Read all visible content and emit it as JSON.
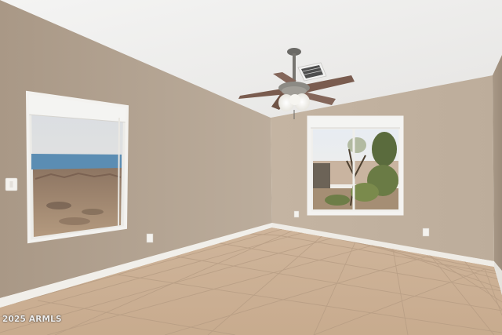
{
  "scene": {
    "description_tag": "empty-room-photo",
    "watermark": "2025 ARMLS"
  },
  "colors": {
    "ceiling": "#eeeeec",
    "wall_left": "#b5a696",
    "wall_back": "#c2b2a0",
    "wall_right": "#a99987",
    "floor": "#ccb196",
    "baseboard": "#f1efea",
    "fan_blade": "#7a5c4f",
    "window_frame": "#f2f2f0"
  }
}
